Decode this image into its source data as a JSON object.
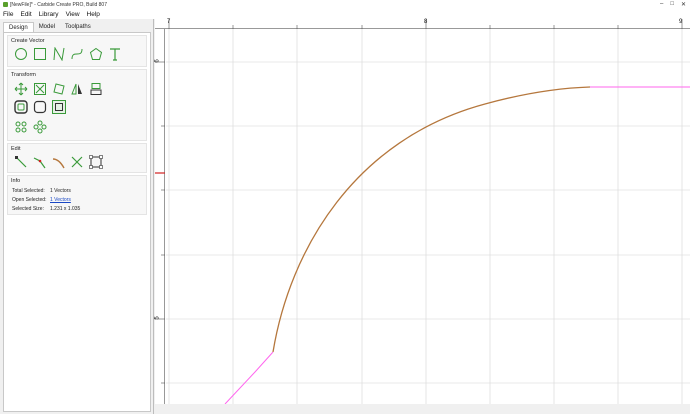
{
  "window": {
    "title": "[NewFile]* - Carbide Create PRO, Build 807",
    "controls": {
      "minimize": "–",
      "maximize": "□",
      "close": "✕"
    }
  },
  "menu": {
    "file": "File",
    "edit": "Edit",
    "library": "Library",
    "view": "View",
    "help": "Help"
  },
  "tabs": {
    "design": "Design",
    "model": "Model",
    "toolpaths": "Toolpaths"
  },
  "sections": {
    "create_vector": "Create Vector",
    "transform": "Transform",
    "edit": "Edit",
    "info": "Info"
  },
  "info": {
    "total_selected_label": "Total Selected:",
    "total_selected_value": "1 Vectors",
    "open_selected_label": "Open Selected:",
    "open_selected_value": "1 Vectors",
    "selected_size_label": "Selected Size:",
    "selected_size_value": "1.231 x 1.035"
  },
  "rulers": {
    "h_labels": {
      "a": "7",
      "b": "8",
      "c": "9"
    },
    "v_labels": {
      "a": "6",
      "b": "5"
    }
  },
  "colors": {
    "icon_green": "#3a9a3a",
    "curve_orange": "#b5773d",
    "open_path_pink": "#ff66ee",
    "marker_red": "#d32020",
    "grid": "#d6d6d6"
  },
  "icons": {
    "create": [
      "circle-icon",
      "rectangle-icon",
      "polyline-icon",
      "curve-icon",
      "polygon-icon",
      "text-icon"
    ],
    "transform": [
      "move-icon",
      "scale-icon",
      "rotate-icon",
      "mirror-icon",
      "align-icon",
      "offset-icon",
      "fillet-icon",
      "boolean-icon",
      "group-icon",
      "ungroup-icon"
    ],
    "edit": [
      "node-edit-icon",
      "join-icon",
      "smooth-icon",
      "trim-icon",
      "bounding-box-icon"
    ]
  }
}
